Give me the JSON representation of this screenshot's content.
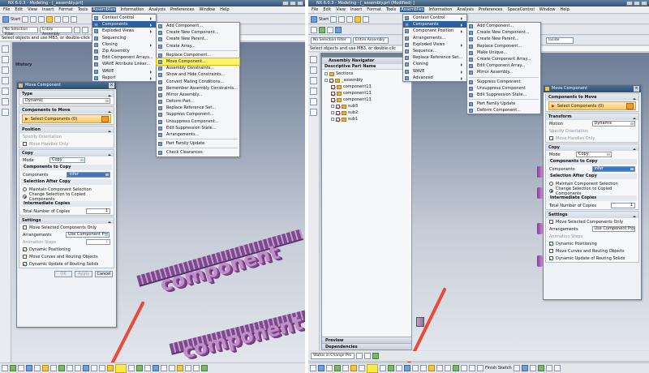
{
  "left": {
    "title": "NX 6.0.3 - Modeling - [_assembly.prt]",
    "menubar": [
      "File",
      "Edit",
      "View",
      "Insert",
      "Format",
      "Tools",
      "Assemblies",
      "Information",
      "Analysis",
      "Preferences",
      "Window",
      "Help"
    ],
    "start_label": "Start",
    "selection_filter": "No Selection Filter",
    "assembly_scope": "Entire Assembly",
    "hint": "Select objects and use MB3, or double-click",
    "history_label": "History",
    "assemblies_menu": [
      {
        "label": "Context Control",
        "sub": true
      },
      {
        "label": "Components",
        "sub": true,
        "hl": true
      },
      {
        "label": "Exploded Views",
        "sub": true
      },
      {
        "label": "Sequencing"
      },
      {
        "label": "Cloning",
        "sub": true
      },
      {
        "label": "Zip Assembly"
      },
      {
        "label": "Edit Component Arrays..."
      },
      {
        "label": "WAVE Attribute Linker..."
      },
      {
        "label": "WAVE",
        "sub": true
      },
      {
        "label": "Report",
        "sub": true
      }
    ],
    "components_menu": [
      {
        "label": "Add Component..."
      },
      {
        "label": "Create New Component..."
      },
      {
        "label": "Create New Parent..."
      },
      {
        "label": "Create Array..."
      },
      {
        "sep": true
      },
      {
        "label": "Replace Component..."
      },
      {
        "label": "Move Component...",
        "yl": true
      },
      {
        "label": "Assembly Constraints..."
      },
      {
        "label": "Show and Hide Constraints..."
      },
      {
        "label": "Convert Mating Conditions..."
      },
      {
        "label": "Remember Assembly Constraints..."
      },
      {
        "label": "Mirror Assembly..."
      },
      {
        "label": "Deform Part..."
      },
      {
        "label": "Replace Reference Set..."
      },
      {
        "label": "Suppress Component..."
      },
      {
        "label": "Unsuppress Component..."
      },
      {
        "label": "Edit Suppression State..."
      },
      {
        "label": "Arrangements..."
      },
      {
        "sep": true
      },
      {
        "label": "Part Family Update"
      },
      {
        "sep": true
      },
      {
        "label": "Check Clearances"
      }
    ],
    "dialog": {
      "title": "Move Component",
      "type_header": "Type",
      "type_value": "Dynamic",
      "components_header": "Components to Move",
      "select_label": "Select Components (0)",
      "position_header": "Position",
      "specify_orientation": "Specify Orientation",
      "move_handles_only": "Move Handles Only",
      "copy_header": "Copy",
      "mode_label": "Mode",
      "mode_value": "Copy",
      "components_to_copy": "Components to Copy",
      "components_label": "Components",
      "components_value": "infer",
      "selection_after_copy": "Selection After Copy",
      "maintain_selection": "Maintain Component Selection",
      "change_selection": "Change Selection to Copied Components",
      "intermediate_copies": "Intermediate Copies",
      "total_copies_label": "Total Number of Copies",
      "total_copies_value": "1",
      "settings_header": "Settings",
      "move_selected_only": "Move Selected Components Only",
      "arrangements_label": "Arrangements",
      "arrangements_value": "Use Component Pro",
      "animation_steps": "Animation Steps",
      "animation_value": "1",
      "dynamic_positioning": "Dynamic Positioning",
      "move_curves": "Move Curves and Routing Objects",
      "dynamic_update": "Dynamic Update of Routing Solids",
      "ok": "OK",
      "apply": "Apply",
      "cancel": "Cancel"
    },
    "graphic_text": "component"
  },
  "right": {
    "title": "NX 6.0.3 - Modeling - [_assembly.prt (Modified) ]",
    "menubar": [
      "File",
      "Edit",
      "View",
      "Insert",
      "Format",
      "Tools",
      "Assemblies",
      "Information",
      "Analysis",
      "Preferences",
      "SpaceControl",
      "Window",
      "Help"
    ],
    "start_label": "Start",
    "selection_filter": "No Selection Filter",
    "assembly_scope": "Entire Assembly",
    "snap_value": "Inside",
    "hint": "Select objects and use MB3, or double-clic",
    "assemblies_menu": [
      {
        "label": "Context Control",
        "sub": true
      },
      {
        "label": "Components",
        "sub": true,
        "hl": true
      },
      {
        "label": "Component Position",
        "sub": true
      },
      {
        "label": "Arrangements..."
      },
      {
        "label": "Exploded Views",
        "sub": true
      },
      {
        "label": "Sequence..."
      },
      {
        "label": "Replace Reference Set..."
      },
      {
        "label": "Cloning",
        "sub": true
      },
      {
        "label": "WAVE",
        "sub": true
      },
      {
        "label": "Advanced",
        "sub": true
      }
    ],
    "components_menu": [
      {
        "label": "Add Component..."
      },
      {
        "label": "Create New Component..."
      },
      {
        "label": "Create New Parent..."
      },
      {
        "label": "Replace Component..."
      },
      {
        "label": "Make Unique..."
      },
      {
        "label": "Create Component Array..."
      },
      {
        "label": "Edit Component Array..."
      },
      {
        "label": "Mirror Assembly..."
      },
      {
        "sep": true
      },
      {
        "label": "Suppress Component"
      },
      {
        "label": "Unsuppress Component"
      },
      {
        "label": "Edit Suppression State..."
      },
      {
        "sep": true
      },
      {
        "label": "Part Family Update"
      },
      {
        "label": "Deform Component..."
      }
    ],
    "navigator": {
      "title": "Assembly Navigator",
      "column": "Descriptive Part Name",
      "items": [
        {
          "label": "Sections",
          "level": 0,
          "type": "folder"
        },
        {
          "label": "_assembly",
          "level": 0,
          "type": "assy"
        },
        {
          "label": "component13",
          "level": 1,
          "type": "part"
        },
        {
          "label": "component13",
          "level": 1,
          "type": "part"
        },
        {
          "label": "component13",
          "level": 1,
          "type": "part"
        },
        {
          "label": "sub3",
          "level": 1,
          "type": "assy"
        },
        {
          "label": "sub2",
          "level": 1,
          "type": "assy"
        },
        {
          "label": "sub1",
          "level": 1,
          "type": "assy"
        }
      ],
      "preview": "Preview",
      "dependencies": "Dependencies"
    },
    "dialog": {
      "title": "Move Component",
      "components_header": "Components to Move",
      "select_label": "Select Components (0)",
      "transform_header": "Transform",
      "motion_label": "Motion",
      "motion_value": "Dynamic",
      "specify_orientation": "Specify Orientation",
      "move_handles_only": "Move Handles Only",
      "copy_header": "Copy",
      "mode_label": "Mode",
      "mode_value": "Copy",
      "components_to_copy": "Components to Copy",
      "components_label": "Components",
      "components_value": "infer",
      "selection_after_copy": "Selection After Copy",
      "maintain_selection": "Maintain Component Selection",
      "change_selection": "Change Selection to Copied Components",
      "intermediate_copies": "Intermediate Copies",
      "total_copies_label": "Total Number of Copies",
      "total_copies_value": "1",
      "settings_header": "Settings",
      "move_selected_only": "Move Selected Components Only",
      "arrangements_label": "Arrangements",
      "arrangements_value": "Use Component Pro",
      "animation_steps": "Animation Steps",
      "dynamic_positioning": "Dynamic Positioning",
      "move_curves": "Move Curves and Routing Objects",
      "dynamic_update": "Dynamic Update of Routing Solids"
    },
    "status_combo": "Status in Change Pro",
    "finish_sketch": "Finish Sketch"
  },
  "colors": {
    "highlight": "#fff36a",
    "menu_select": "#2d5fa3",
    "arrow": "#e94a3a",
    "component": "#c08fc8"
  }
}
